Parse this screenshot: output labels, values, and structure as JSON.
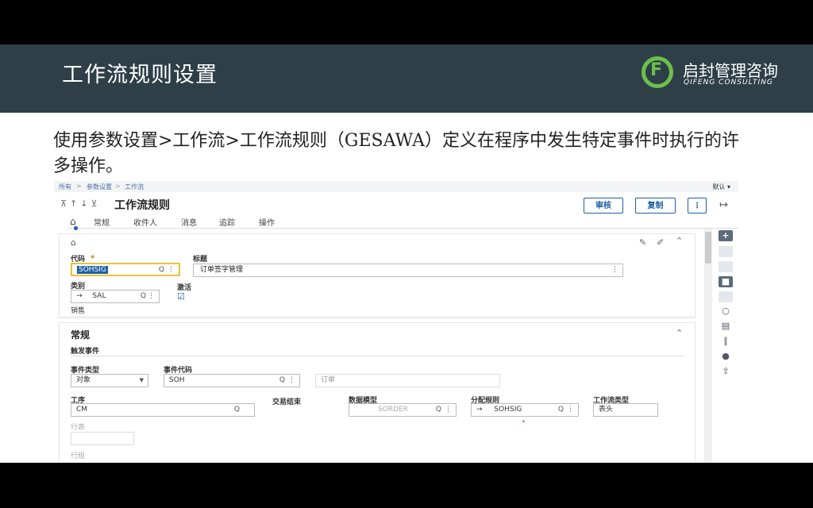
{
  "slide": {
    "title": "工作流规则设置",
    "logo_cn": "启封管理咨询",
    "logo_en": "QIFENG CONSULTING",
    "description": "使用参数设置>工作流>工作流规则（GESAWA）定义在程序中发生特定事件时执行的许多操作。"
  },
  "breadcrumb": {
    "items": [
      "所有",
      "参数设置",
      "工作流"
    ],
    "sep": ">",
    "default_label": "默认 ▾"
  },
  "page": {
    "arrows": "⊼↑↓⊻",
    "title": "工作流规则"
  },
  "toolbar": {
    "audit": "审核",
    "copy": "复制",
    "more": "⋮",
    "exit": "↦"
  },
  "tabs": [
    "常规",
    "收件人",
    "消息",
    "追踪",
    "操作"
  ],
  "header_card": {
    "code_label": "代码",
    "required_mark": "★",
    "code_value": "SOHSIG",
    "title_label": "标题",
    "title_value": "订单签字管理",
    "category_label": "类别",
    "category_value": "SAL",
    "category_desc": "销售",
    "active_label": "激活",
    "active_check": "☑"
  },
  "general": {
    "section_title": "常规",
    "trigger_title": "触发事件",
    "event_type_label": "事件类型",
    "event_type_value": "对象",
    "event_code_label": "事件代码",
    "event_code_value": "SOH",
    "event_code_desc": "订单",
    "process_label": "工序",
    "process_value": "CM",
    "tx_end_label": "交易结束",
    "data_model_label": "数据模型",
    "data_model_value": "SORDER",
    "alloc_rule_label": "分配规则",
    "alloc_rule_value": "SOHSIG",
    "wf_type_label": "工作流类型",
    "wf_type_value": "表头",
    "row_table_label": "行表",
    "row_group_label": "行组"
  },
  "icons": {
    "home": "⌂",
    "search": "🔍",
    "more": "⋮",
    "arrow": "→",
    "chevron_up": "⌃"
  },
  "colors": {
    "header_bg": "#2f3f48",
    "accent": "#1d5fa3",
    "logo_green": "#6cc04a"
  }
}
